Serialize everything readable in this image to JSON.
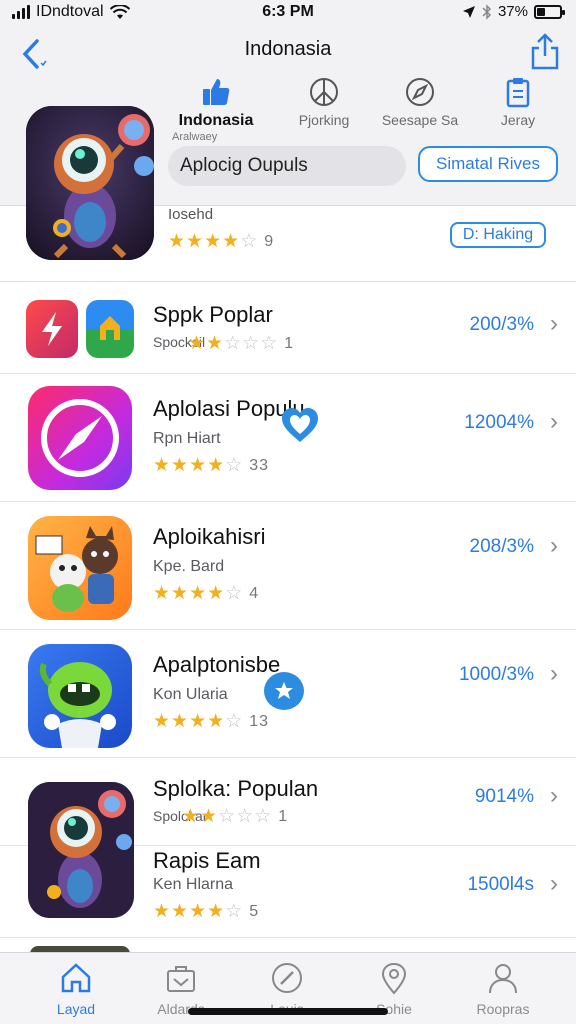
{
  "status_bar": {
    "carrier": "IDndtoval",
    "time": "6:3 PM",
    "battery": "37%",
    "battery_level": 0.37
  },
  "header": {
    "title": "Indonasia",
    "back_icon": "chevron-left-icon",
    "share_icon": "share-icon"
  },
  "segments": [
    {
      "label": "Indonasia",
      "icon": "thumbs-up-icon",
      "active": true
    },
    {
      "label": "Pjorking",
      "icon": "peace-icon",
      "active": false
    },
    {
      "label": "Seesape Sa",
      "icon": "compass-icon",
      "active": false
    },
    {
      "label": "Jeray",
      "icon": "clipboard-icon",
      "active": false
    }
  ],
  "hero": {
    "subtitle": "Aralwaey"
  },
  "search": {
    "placeholder": "Aplocig Oupuls"
  },
  "outline_button": "Simatal Rives",
  "first_row": {
    "subtitle": "Iosehd",
    "rating": 4,
    "rating_count": "9",
    "action_label": "D: Haking"
  },
  "rows": [
    {
      "title": "Sppk Poplar",
      "subtitle": "Spocksil",
      "rating": 2,
      "rating_count": "1",
      "percent": "200/3%",
      "icon": "lightning-apps-icon"
    },
    {
      "title": "Aplolasi Populu",
      "subtitle": "Rpn Hiart",
      "rating": 4,
      "rating_count": "33",
      "percent": "12004%",
      "icon": "compass-app-icon",
      "badge": "heart-badge-icon"
    },
    {
      "title": "Aploikahisri",
      "subtitle": "Kpe. Bard",
      "rating": 4,
      "rating_count": "4",
      "percent": "208/3%",
      "icon": "cartoon-characters-app-icon"
    },
    {
      "title": "Apalptonisbe",
      "subtitle": "Kon Ularia",
      "rating": 4,
      "rating_count": "13",
      "percent": "1000/3%",
      "icon": "green-monster-app-icon",
      "badge": "star-badge-icon"
    },
    {
      "title": "Splolka: Populan",
      "subtitle": "Spolckar",
      "rating": 2,
      "rating_count": "1",
      "percent": "9014%",
      "icon": "robot-character-app-icon"
    },
    {
      "title": "Rapis Eam",
      "subtitle": "Ken Hlarna",
      "rating": 4,
      "rating_count": "5",
      "percent": "1500l4s",
      "icon": ""
    }
  ],
  "tabs": [
    {
      "label": "Layad",
      "icon": "home-icon",
      "active": true
    },
    {
      "label": "Aldards",
      "icon": "briefcase-icon",
      "active": false
    },
    {
      "label": "Louis",
      "icon": "compass-icon",
      "active": false
    },
    {
      "label": "Sohie",
      "icon": "location-pin-icon",
      "active": false
    },
    {
      "label": "Roopras",
      "icon": "person-icon",
      "active": false
    }
  ],
  "colors": {
    "accent": "#2c7be5",
    "star": "#f2b01e",
    "header_bg": "#f2f2f4"
  }
}
